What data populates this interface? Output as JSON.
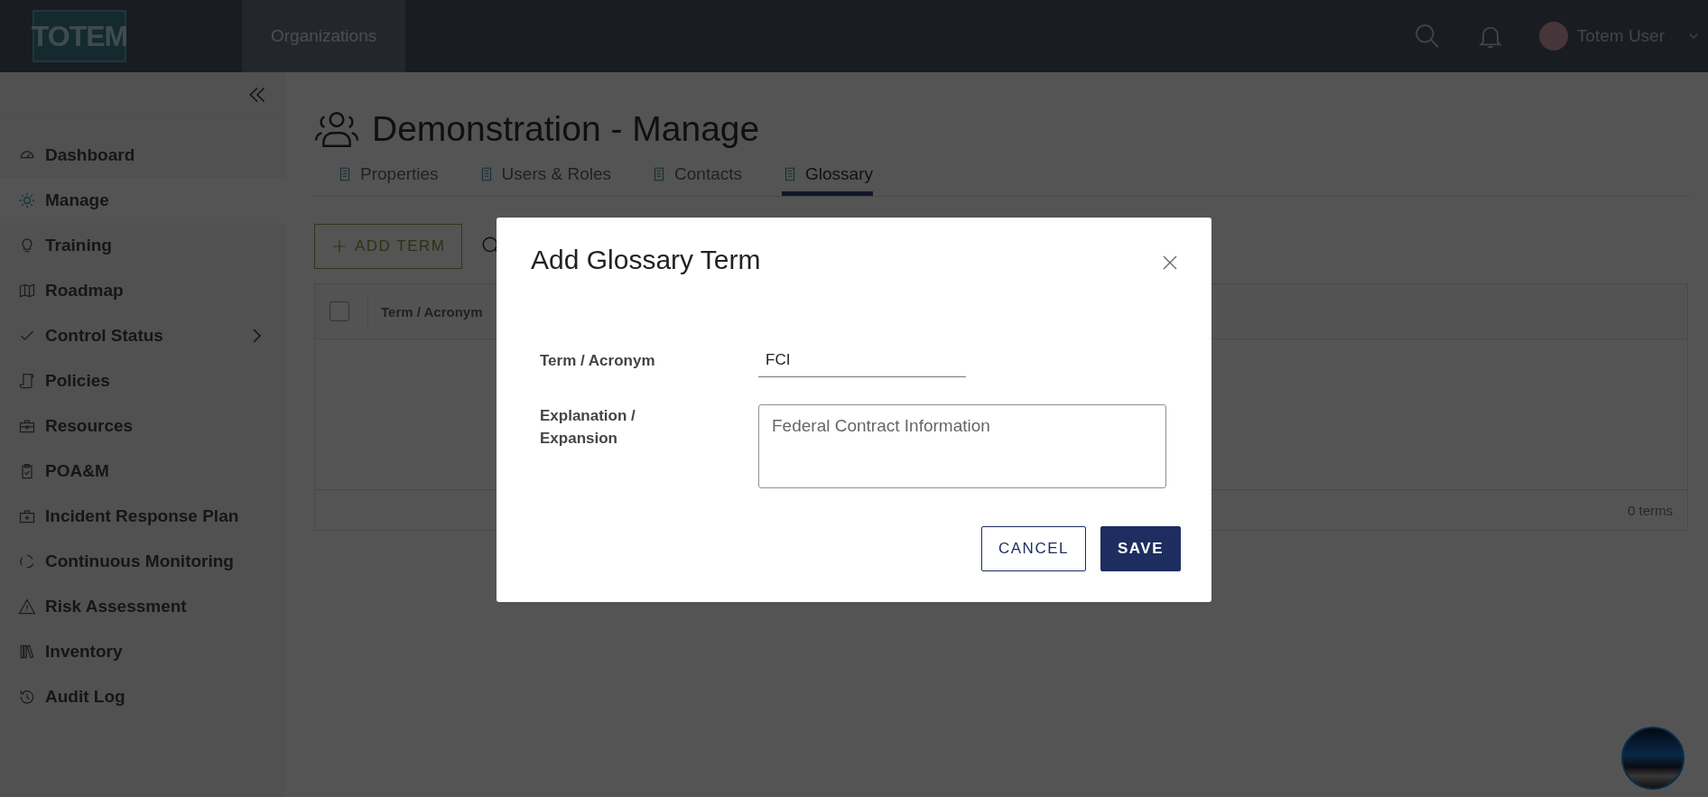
{
  "header": {
    "logo": "TOTEM",
    "nav": [
      {
        "label": "Organizations",
        "selected": true
      }
    ],
    "user": {
      "name": "Totem User"
    }
  },
  "sidebar": {
    "items": [
      {
        "label": "Dashboard",
        "selected": false,
        "expandable": false
      },
      {
        "label": "Manage",
        "selected": true,
        "expandable": false
      },
      {
        "label": "Training",
        "selected": false,
        "expandable": false
      },
      {
        "label": "Roadmap",
        "selected": false,
        "expandable": false
      },
      {
        "label": "Control Status",
        "selected": false,
        "expandable": true
      },
      {
        "label": "Policies",
        "selected": false,
        "expandable": false
      },
      {
        "label": "Resources",
        "selected": false,
        "expandable": false
      },
      {
        "label": "POA&M",
        "selected": false,
        "expandable": false
      },
      {
        "label": "Incident Response Plan",
        "selected": false,
        "expandable": false
      },
      {
        "label": "Continuous Monitoring",
        "selected": false,
        "expandable": false
      },
      {
        "label": "Risk Assessment",
        "selected": false,
        "expandable": false
      },
      {
        "label": "Inventory",
        "selected": false,
        "expandable": false
      },
      {
        "label": "Audit Log",
        "selected": false,
        "expandable": false
      }
    ]
  },
  "page": {
    "title": "Demonstration - Manage",
    "tabs": [
      {
        "label": "Properties",
        "selected": false
      },
      {
        "label": "Users & Roles",
        "selected": false
      },
      {
        "label": "Contacts",
        "selected": false
      },
      {
        "label": "Glossary",
        "selected": true
      }
    ]
  },
  "toolbar": {
    "add_button": "ADD TERM"
  },
  "table": {
    "select_all": {
      "checked": false
    },
    "columns": [
      "Term / Acronym"
    ],
    "footer": "0 terms"
  },
  "modal": {
    "title": "Add Glossary Term",
    "fields": [
      {
        "kind": "input",
        "label": "Term / Acronym",
        "value": "FCI"
      },
      {
        "kind": "textarea",
        "label": "Explanation / Expansion",
        "value": "Federal Contract Information"
      }
    ],
    "buttons": [
      {
        "kind": "secondary",
        "label": "CANCEL"
      },
      {
        "kind": "primary",
        "label": "SAVE"
      }
    ]
  }
}
